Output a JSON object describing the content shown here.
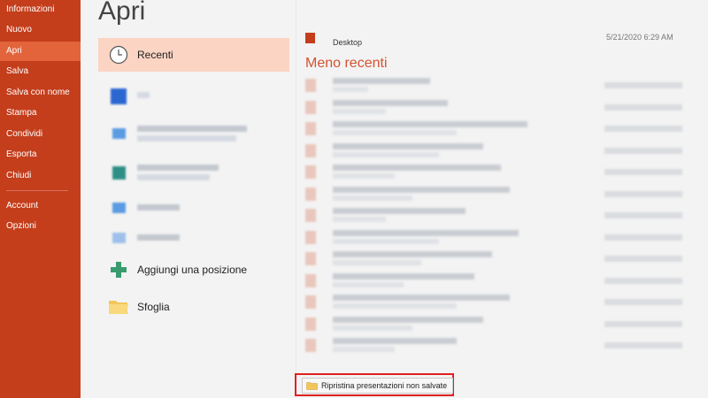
{
  "nav": {
    "items": [
      {
        "label": "Informazioni"
      },
      {
        "label": "Nuovo"
      },
      {
        "label": "Apri"
      },
      {
        "label": "Salva"
      },
      {
        "label": "Salva con nome"
      },
      {
        "label": "Stampa"
      },
      {
        "label": "Condividi"
      },
      {
        "label": "Esporta"
      },
      {
        "label": "Chiudi"
      },
      {
        "label": "Account"
      },
      {
        "label": "Opzioni"
      }
    ],
    "active": "Apri"
  },
  "page": {
    "title": "Apri"
  },
  "locations": {
    "recent": "Recenti",
    "add": "Aggiungi una posizione",
    "browse": "Sfoglia"
  },
  "files": {
    "top_item_name": "Desktop",
    "top_item_date": "5/21/2020 6:29 AM",
    "section_title": "Meno recenti"
  },
  "restore": {
    "label": "Ripristina presentazioni non salvate"
  },
  "colors": {
    "accent": "#c43e1c",
    "accent_active": "#e3643b",
    "section_title": "#d35230",
    "selected_loc": "#fbd4c3"
  }
}
